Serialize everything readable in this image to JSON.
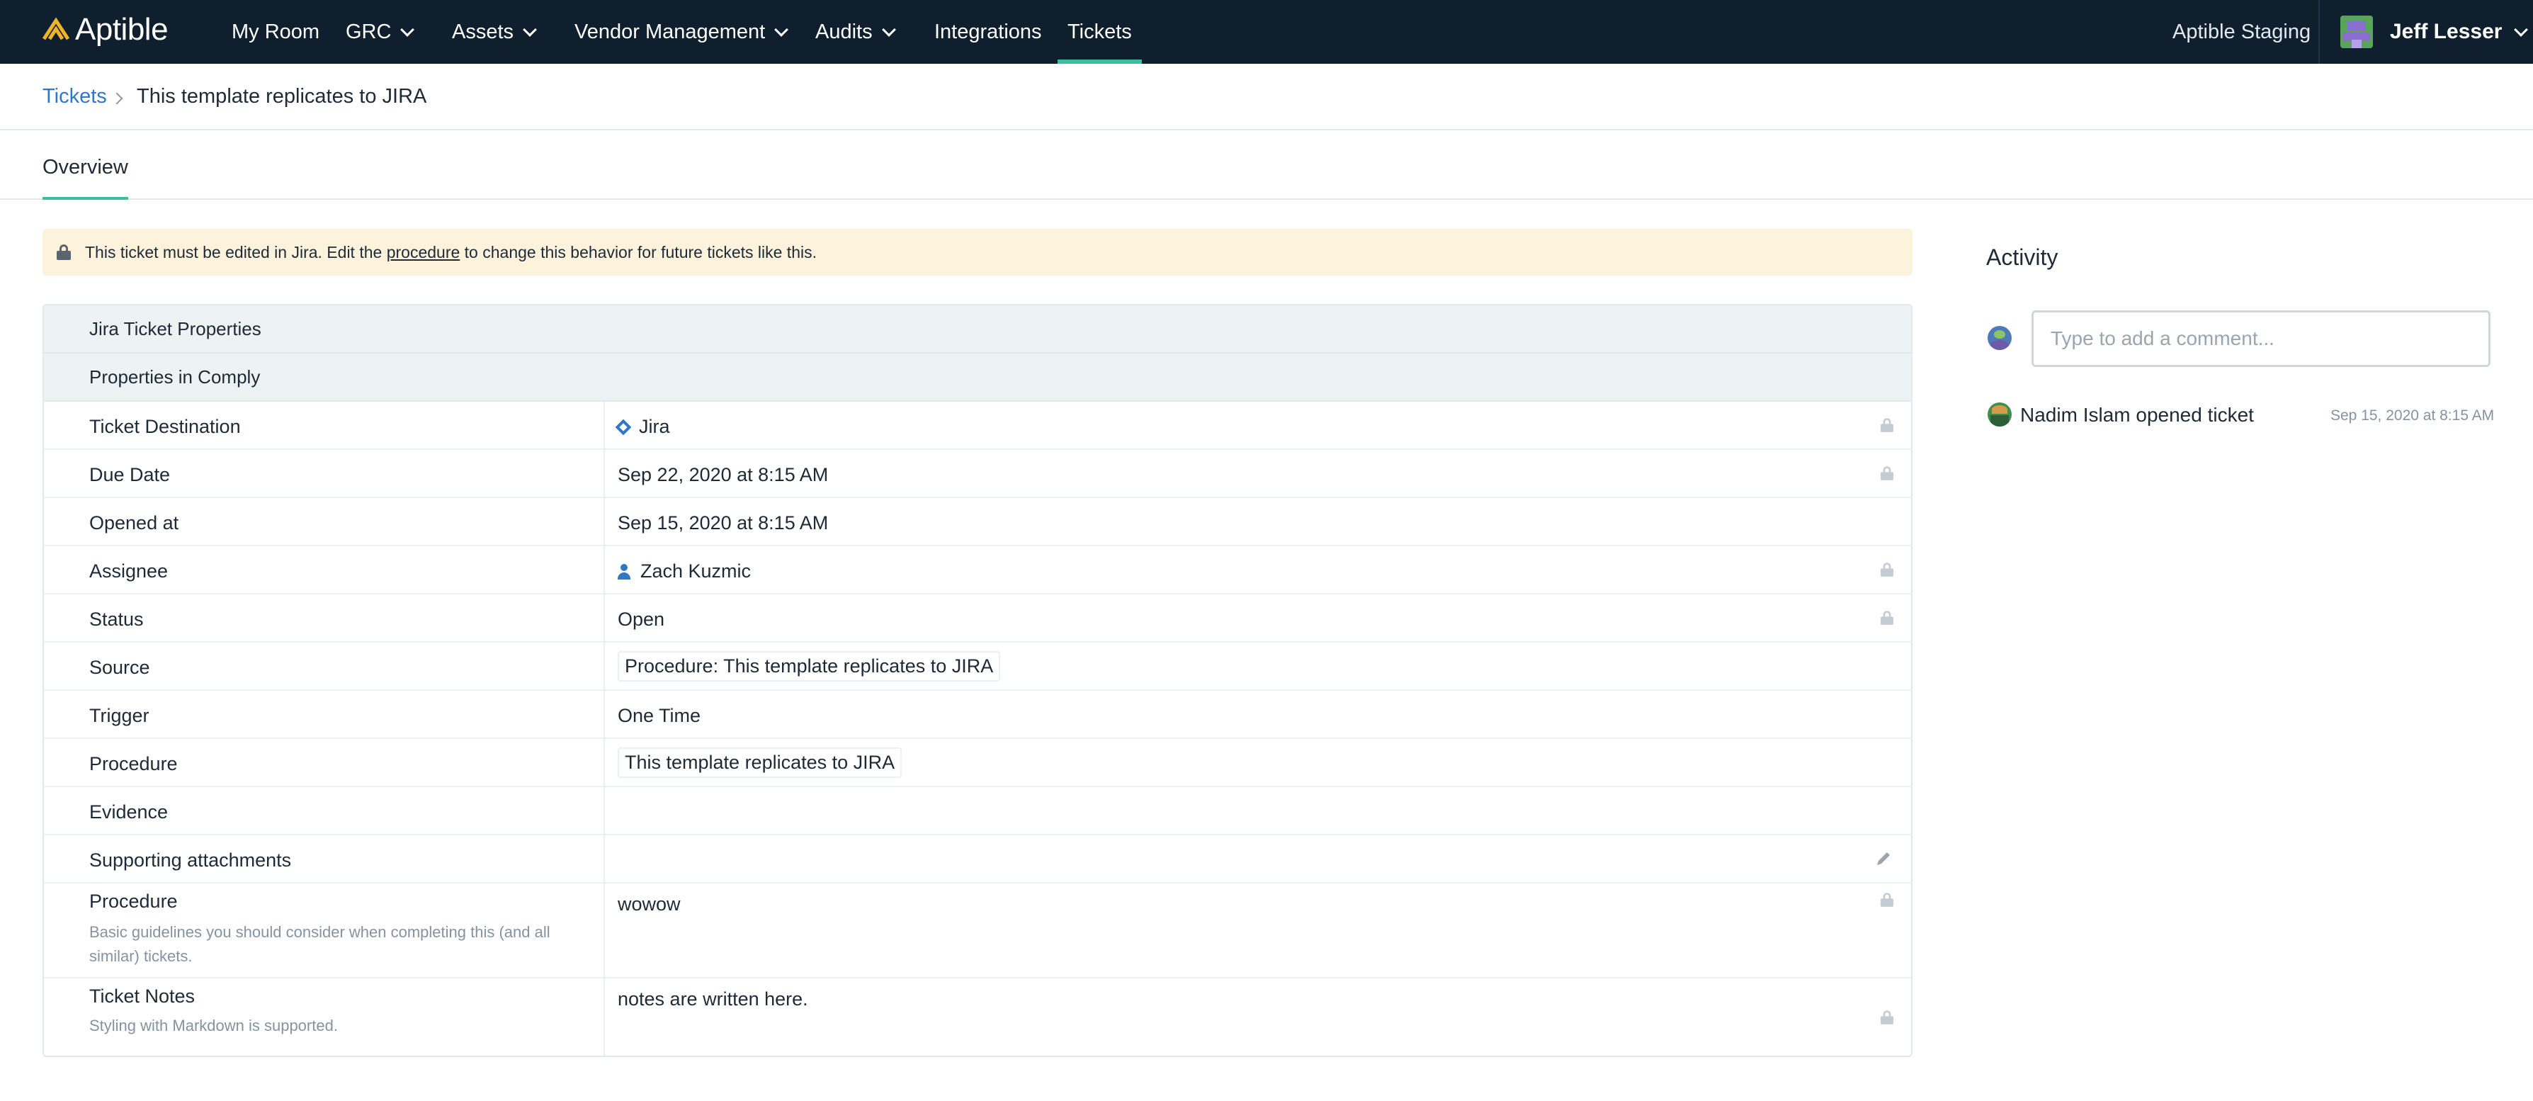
{
  "app": {
    "brand": "Aptible",
    "environment": "Aptible Staging"
  },
  "nav": {
    "items": [
      {
        "label": "My Room",
        "has_dropdown": false
      },
      {
        "label": "GRC",
        "has_dropdown": true
      },
      {
        "label": "Assets",
        "has_dropdown": true
      },
      {
        "label": "Vendor Management",
        "has_dropdown": true
      },
      {
        "label": "Audits",
        "has_dropdown": true
      },
      {
        "label": "Integrations",
        "has_dropdown": false
      },
      {
        "label": "Tickets",
        "has_dropdown": false,
        "active": true
      }
    ]
  },
  "user": {
    "name": "Jeff Lesser"
  },
  "breadcrumb": {
    "parent": "Tickets",
    "current": "This template replicates to JIRA"
  },
  "tabs": [
    {
      "label": "Overview",
      "active": true
    }
  ],
  "notice": {
    "prefix": "This ticket must be edited in Jira. Edit the ",
    "link": "procedure",
    "suffix": " to change this behavior for future tickets like this."
  },
  "properties": {
    "section_jira": "Jira Ticket Properties",
    "section_comply": "Properties in Comply",
    "rows": {
      "destination": {
        "label": "Ticket Destination",
        "value": "Jira",
        "icon": "jira-diamond-icon",
        "locked": true
      },
      "due_date": {
        "label": "Due Date",
        "value": "Sep 22, 2020 at 8:15 AM",
        "locked": true
      },
      "opened_at": {
        "label": "Opened at",
        "value": "Sep 15, 2020 at 8:15 AM",
        "locked": false
      },
      "assignee": {
        "label": "Assignee",
        "value": "Zach Kuzmic",
        "icon": "person-icon",
        "locked": true
      },
      "status": {
        "label": "Status",
        "value": "Open",
        "locked": true
      },
      "source": {
        "label": "Source",
        "value": "Procedure: This template replicates to JIRA",
        "locked": false
      },
      "trigger": {
        "label": "Trigger",
        "value": "One Time",
        "locked": false
      },
      "procedure_link": {
        "label": "Procedure",
        "value": "This template replicates to JIRA",
        "locked": false
      },
      "evidence": {
        "label": "Evidence",
        "value": "",
        "locked": false
      },
      "attachments": {
        "label": "Supporting attachments",
        "value": "",
        "editable": true
      },
      "procedure_text": {
        "label": "Procedure",
        "help": "Basic guidelines you should consider when completing this (and all similar) tickets.",
        "value": "wowow",
        "locked": true
      },
      "notes": {
        "label": "Ticket Notes",
        "help": "Styling with Markdown is supported.",
        "value": "notes are written here.",
        "locked": true
      }
    }
  },
  "activity": {
    "title": "Activity",
    "comment_placeholder": "Type to add a comment...",
    "events": [
      {
        "text": "Nadim Islam opened ticket",
        "time": "Sep 15, 2020 at 8:15 AM"
      }
    ]
  },
  "colors": {
    "topbar": "#0f1f2e",
    "accent": "#3cbf9b",
    "link": "#2f78c4",
    "notice_bg": "#fdf3dc",
    "section_bg": "#edf2f5"
  }
}
